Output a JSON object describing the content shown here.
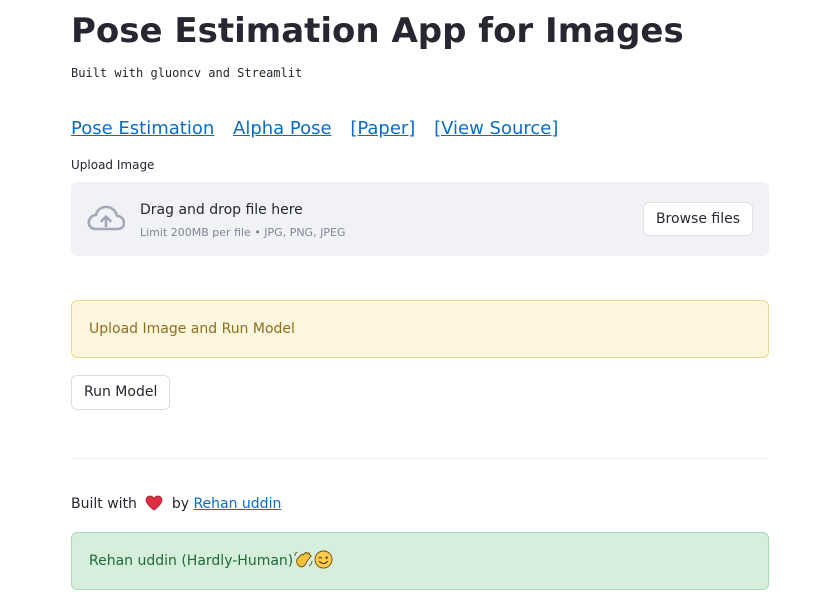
{
  "header": {
    "title": "Pose Estimation App for Images",
    "subtitle": "Built with gluoncv and Streamlit"
  },
  "links": [
    {
      "label": "Pose Estimation"
    },
    {
      "label": "Alpha Pose"
    },
    {
      "label": "[Paper]"
    },
    {
      "label": "[View Source]"
    }
  ],
  "uploader": {
    "label": "Upload Image",
    "drop_text": "Drag and drop file here",
    "limit_text": "Limit 200MB per file • JPG, PNG, JPEG",
    "browse_label": "Browse files",
    "icon": "cloud-upload-icon"
  },
  "warning": {
    "text": "Upload Image and Run Model"
  },
  "run_button": {
    "label": "Run Model"
  },
  "footer": {
    "built_with": "Built with",
    "by": "by",
    "author_link": "Rehan uddin",
    "heart_icon": "heart-icon"
  },
  "success": {
    "text": "Rehan uddin (Hardly-Human)",
    "emojis": [
      "waving-hand-icon",
      "winking-face-icon"
    ]
  },
  "colors": {
    "link": "#0b6cc5",
    "warning_bg": "#fef6dd",
    "success_bg": "#d6eedc",
    "dropzone_bg": "#f0f2f6"
  }
}
